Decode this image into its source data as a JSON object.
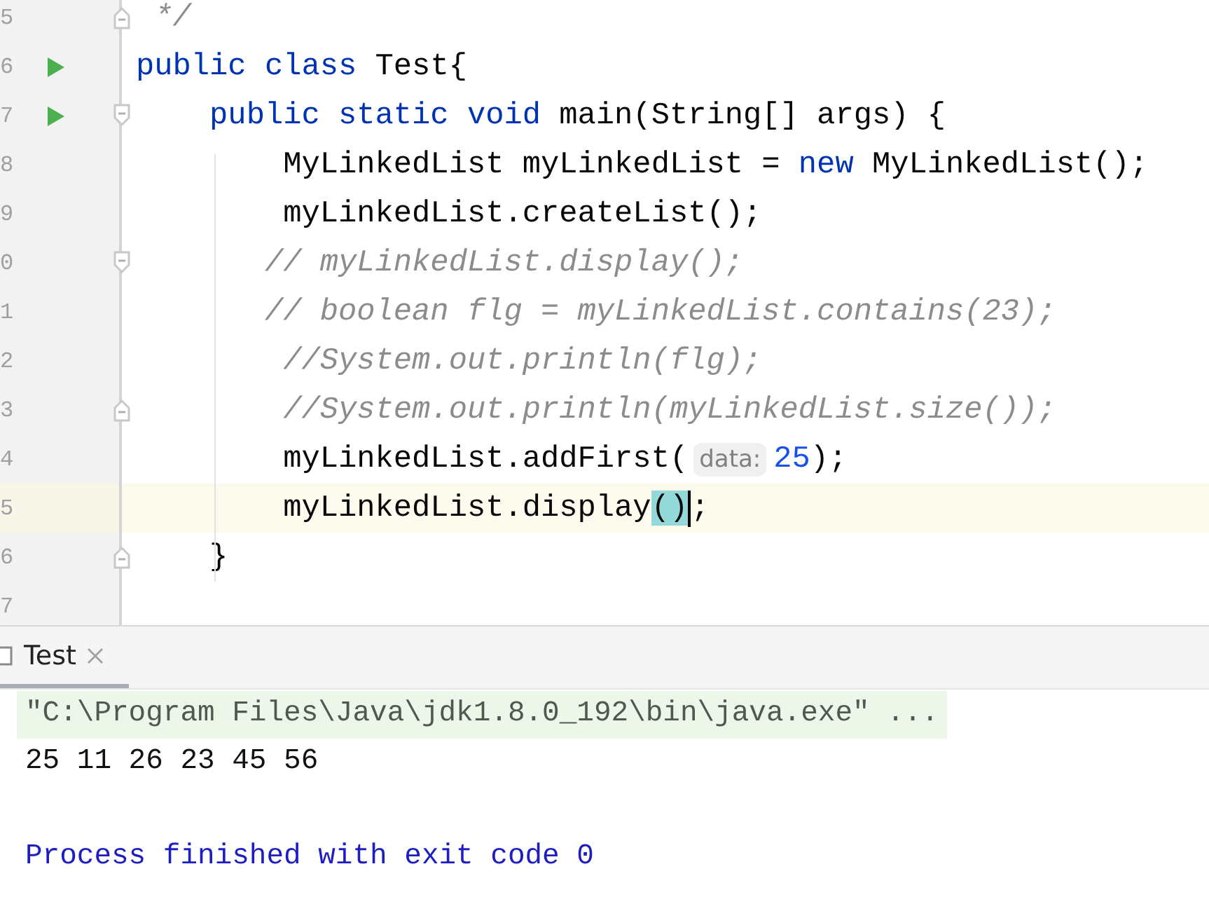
{
  "editor": {
    "lines": [
      {
        "number": "5",
        "run": false,
        "fold_start": false,
        "fold_end": true,
        "current": false,
        "tokens": [
          {
            "kind": "comment",
            "text": " */"
          }
        ]
      },
      {
        "number": "6",
        "run": true,
        "fold_start": false,
        "fold_end": false,
        "current": false,
        "tokens": [
          {
            "kind": "keyword",
            "text": "public class "
          },
          {
            "kind": "plain",
            "text": "Test{"
          }
        ]
      },
      {
        "number": "7",
        "run": true,
        "fold_start": true,
        "fold_end": false,
        "current": false,
        "tokens": [
          {
            "kind": "keyword",
            "text": "    public static void "
          },
          {
            "kind": "plain",
            "text": "main(String[] args) {"
          }
        ]
      },
      {
        "number": "8",
        "run": false,
        "fold_start": false,
        "fold_end": false,
        "current": false,
        "tokens": [
          {
            "kind": "plain",
            "text": "        MyLinkedList myLinkedList = "
          },
          {
            "kind": "keyword",
            "text": "new "
          },
          {
            "kind": "plain",
            "text": "MyLinkedList();"
          }
        ]
      },
      {
        "number": "9",
        "run": false,
        "fold_start": false,
        "fold_end": false,
        "current": false,
        "tokens": [
          {
            "kind": "plain",
            "text": "        myLinkedList.createList();"
          }
        ]
      },
      {
        "number": "0",
        "run": false,
        "fold_start": true,
        "fold_end": false,
        "current": false,
        "tokens": [
          {
            "kind": "comment",
            "text": "       // myLinkedList.display();"
          }
        ]
      },
      {
        "number": "1",
        "run": false,
        "fold_start": false,
        "fold_end": false,
        "current": false,
        "tokens": [
          {
            "kind": "comment",
            "text": "       // boolean flg = myLinkedList.contains(23);"
          }
        ]
      },
      {
        "number": "2",
        "run": false,
        "fold_start": false,
        "fold_end": false,
        "current": false,
        "tokens": [
          {
            "kind": "comment",
            "text": "        //System.out.println(flg);"
          }
        ]
      },
      {
        "number": "3",
        "run": false,
        "fold_start": false,
        "fold_end": true,
        "current": false,
        "tokens": [
          {
            "kind": "comment",
            "text": "        //System.out.println(myLinkedList.size());"
          }
        ]
      },
      {
        "number": "4",
        "run": false,
        "fold_start": false,
        "fold_end": false,
        "current": false,
        "tokens": [
          {
            "kind": "plain",
            "text": "        myLinkedList.addFirst("
          },
          {
            "kind": "hint",
            "text": "data:"
          },
          {
            "kind": "number",
            "text": "25"
          },
          {
            "kind": "plain",
            "text": ");"
          }
        ]
      },
      {
        "number": "5",
        "run": false,
        "fold_start": false,
        "fold_end": false,
        "current": true,
        "tokens": [
          {
            "kind": "plain",
            "text": "        myLinkedList.display"
          },
          {
            "kind": "matched",
            "text": "()"
          },
          {
            "kind": "caret"
          },
          {
            "kind": "plain",
            "text": ";"
          }
        ]
      },
      {
        "number": "6",
        "run": false,
        "fold_start": false,
        "fold_end": true,
        "current": false,
        "tokens": [
          {
            "kind": "plain",
            "text": "    }"
          }
        ]
      },
      {
        "number": "7",
        "run": false,
        "fold_start": false,
        "fold_end": false,
        "current": false
      }
    ]
  },
  "console": {
    "tabs": [
      {
        "label": "Test",
        "selected": true
      }
    ],
    "lines": [
      {
        "kind": "command",
        "text": "\"C:\\Program Files\\Java\\jdk1.8.0_192\\bin\\java.exe\" ..."
      },
      {
        "kind": "output",
        "text": "25 11 26 23 45 56"
      },
      {
        "kind": "blank"
      },
      {
        "kind": "system",
        "text": "Process finished with exit code 0"
      }
    ]
  }
}
